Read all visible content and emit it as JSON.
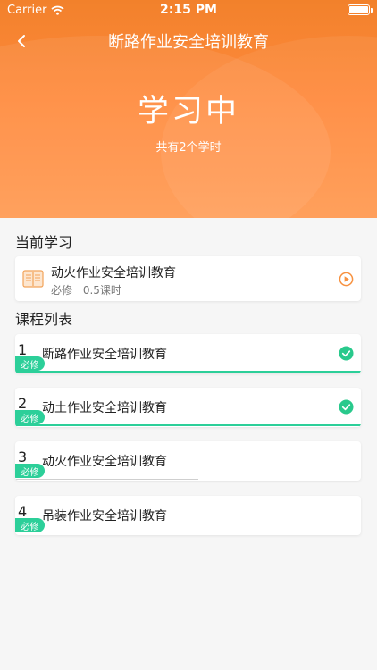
{
  "status_bar": {
    "carrier": "Carrier",
    "time": "2:15 PM"
  },
  "nav": {
    "title": "断路作业安全培训教育"
  },
  "hero": {
    "title": "学习中",
    "subtitle": "共有2个学时"
  },
  "current": {
    "section_title": "当前学习",
    "course_title": "动火作业安全培训教育",
    "required_label": "必修",
    "hours": "0.5课时"
  },
  "course_list": {
    "section_title": "课程列表",
    "items": [
      {
        "num": "1",
        "name": "断路作业安全培训教育",
        "badge": "必修",
        "progress": 1.0,
        "completed": true
      },
      {
        "num": "2",
        "name": "动土作业安全培训教育",
        "badge": "必修",
        "progress": 1.0,
        "completed": true
      },
      {
        "num": "3",
        "name": "动火作业安全培训教育",
        "badge": "必修",
        "progress": 0.53,
        "completed": false
      },
      {
        "num": "4",
        "name": "吊装作业安全培训教育",
        "badge": "必修",
        "progress": 0,
        "completed": false
      }
    ]
  },
  "colors": {
    "accent_orange": "#ff8a3d",
    "accent_green": "#2ccf99",
    "check_green": "#29c98c"
  }
}
